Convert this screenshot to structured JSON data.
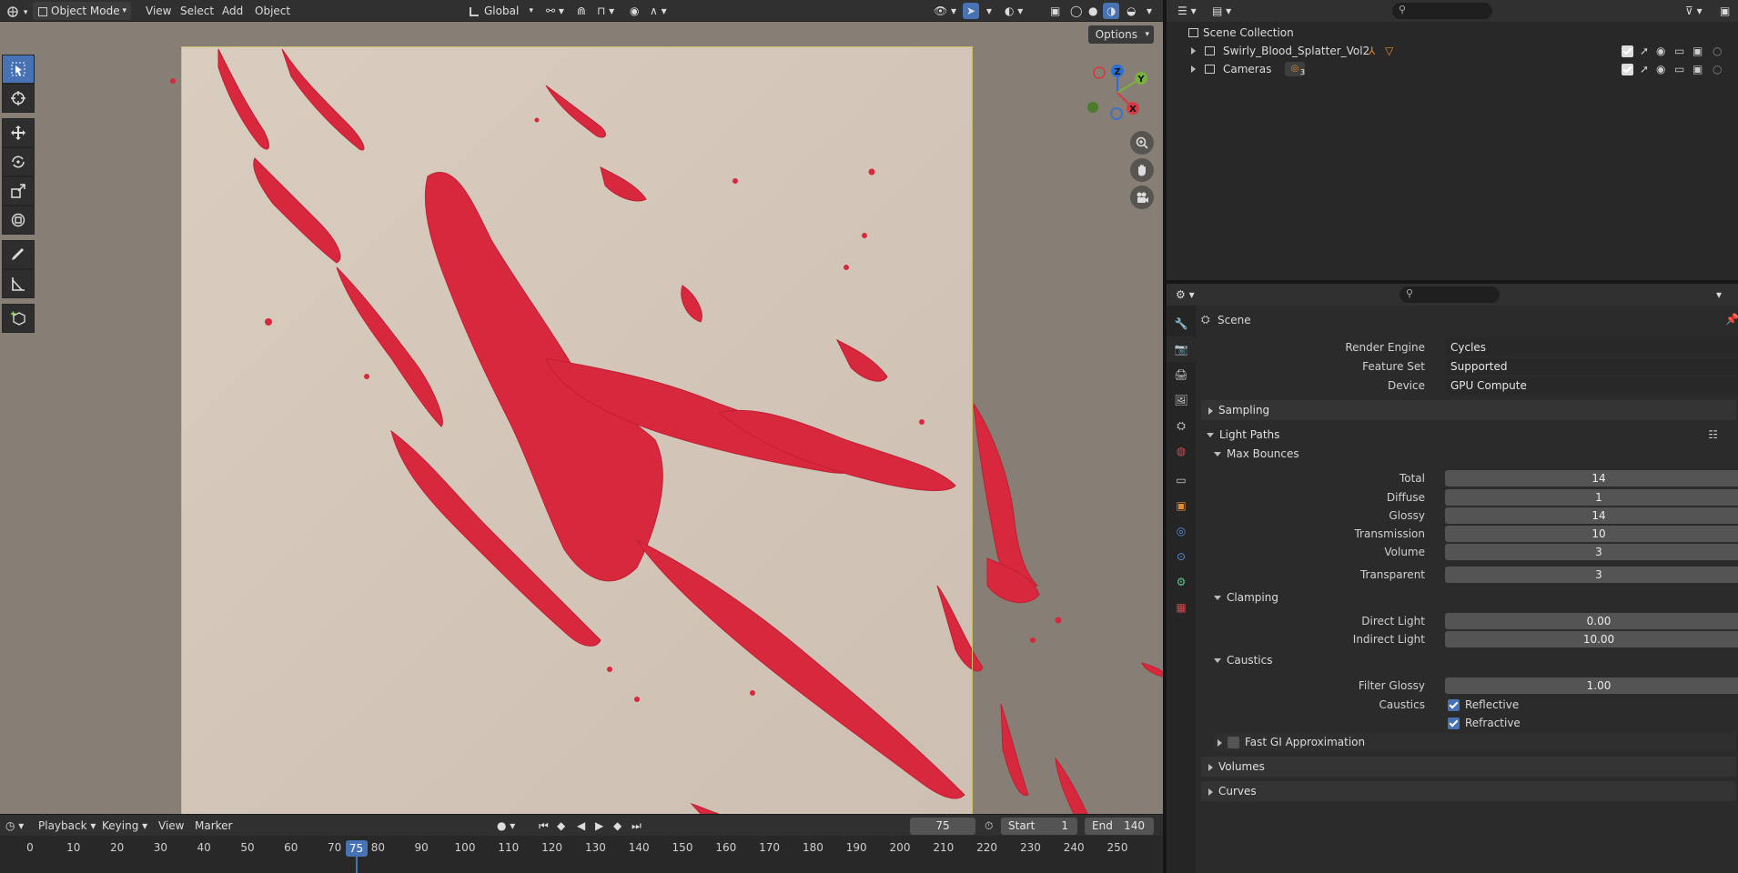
{
  "header": {
    "mode": "Object Mode",
    "menus": [
      "View",
      "Select",
      "Add",
      "Object"
    ],
    "transform_orientation": "Global"
  },
  "viewport": {
    "options_label": "Options",
    "axes": [
      "Z",
      "Y",
      "X"
    ]
  },
  "timeline": {
    "menus": [
      "Playback",
      "Keying",
      "View",
      "Marker"
    ],
    "current_frame": "75",
    "start_label": "Start",
    "start_value": "1",
    "end_label": "End",
    "end_value": "140",
    "ticks": [
      "0",
      "10",
      "20",
      "30",
      "40",
      "50",
      "60",
      "70",
      "80",
      "90",
      "100",
      "110",
      "120",
      "130",
      "140",
      "150",
      "160",
      "170",
      "180",
      "190",
      "200",
      "210",
      "220",
      "230",
      "240",
      "250"
    ],
    "playhead": "75"
  },
  "outliner": {
    "root": "Scene Collection",
    "items": [
      {
        "label": "Swirly_Blood_Splatter_Vol2"
      },
      {
        "label": "Cameras",
        "badge": "3"
      }
    ]
  },
  "properties": {
    "context": "Scene",
    "render_engine_label": "Render Engine",
    "render_engine": "Cycles",
    "feature_set_label": "Feature Set",
    "feature_set": "Supported",
    "device_label": "Device",
    "device": "GPU Compute",
    "sampling": "Sampling",
    "light_paths": "Light Paths",
    "max_bounces": "Max Bounces",
    "bounces": [
      {
        "label": "Total",
        "value": "14"
      },
      {
        "label": "Diffuse",
        "value": "1"
      },
      {
        "label": "Glossy",
        "value": "14"
      },
      {
        "label": "Transmission",
        "value": "10"
      },
      {
        "label": "Volume",
        "value": "3"
      },
      {
        "label": "Transparent",
        "value": "3"
      }
    ],
    "clamping": "Clamping",
    "clamp": [
      {
        "label": "Direct Light",
        "value": "0.00"
      },
      {
        "label": "Indirect Light",
        "value": "10.00"
      }
    ],
    "caustics": "Caustics",
    "filter_glossy_label": "Filter Glossy",
    "filter_glossy": "1.00",
    "caustics_label": "Caustics",
    "reflective": "Reflective",
    "refractive": "Refractive",
    "fast_gi": "Fast GI Approximation",
    "volumes": "Volumes",
    "curves": "Curves"
  },
  "colors": {
    "accent": "#4772b3",
    "blood": "#d8283e",
    "backdrop": "#d6c8ba"
  }
}
